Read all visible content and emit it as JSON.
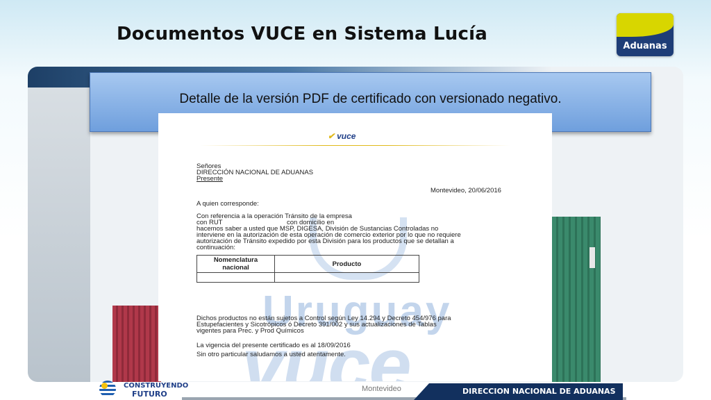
{
  "slide": {
    "title": "Documentos VUCE en Sistema Lucía",
    "logo_text": "Aduanas",
    "caption": "Detalle de la versión PDF de certificado con versionado negativo."
  },
  "document": {
    "header_logo": "vuce",
    "addressee": [
      "Señores",
      "DIRECCIÓN NACIONAL DE ADUANAS",
      "Presente"
    ],
    "place_date": "Montevideo, 20/06/2016",
    "greeting": "A quien corresponde:",
    "body_lines": [
      "Con referencia a la operación Tránsito de la empresa",
      "con RUT",
      "con domicilio en",
      "hacemos saber a usted que MSP, DIGESA, División de Sustancias Controladas no",
      "interviene en la autorización de esta operación de comercio exterior por lo que no requiere",
      "autorización de Tránsito expedido por esta División para los productos que se detallan a",
      "continuación:"
    ],
    "table_headers": [
      "Nomenclatura\nnacional",
      "Producto"
    ],
    "control_lines": [
      "Dichos productos no están sujetos a Control según Ley 14.294 y Decreto 454/976 para",
      "Estupefacientes y Sicotrópicos ó Decreto 391/002 y sus actualizaciones de Tablas",
      "vigentes para Prec. y Prod Químicos"
    ],
    "validity": "La vigencia del presente certificado es al 18/09/2016",
    "closing": "Sin otro particular saludamos a usted atentamente.",
    "watermark_top": "Uruguay",
    "watermark_bottom": "vuce"
  },
  "footer": {
    "brand_line1": "CONSTRUYENDO",
    "brand_line2": "FUTURO",
    "center": "Montevideo",
    "right": "DIRECCION NACIONAL DE ADUANAS"
  },
  "colors": {
    "banner": "#8fb5e8",
    "footer_dark": "#12305e",
    "logo_blue": "#1e3d77",
    "logo_yellow": "#d8d600"
  }
}
